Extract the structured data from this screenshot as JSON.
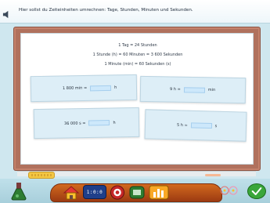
{
  "instruction": "Hier sollst du Zeiteinheiten umrechnen: Tage, Stunden, Minuten und Sekunden.",
  "rules": [
    "1 Tag = 24 Stunden",
    "1 Stunde (h) = 60 Minuten = 3 600 Sekunden",
    "1 Minute (min) = 60 Sekunden (s)"
  ],
  "exercises": [
    {
      "left": "1 800 min =",
      "value": "",
      "unit": "h"
    },
    {
      "left": "9 h =",
      "value": "",
      "unit": "min"
    },
    {
      "left": "36 000 s =",
      "value": "",
      "unit": "h"
    },
    {
      "left": "5 h =",
      "value": "",
      "unit": "s"
    }
  ],
  "toolbar": {
    "calculator_label": "1:0:0",
    "icons": [
      "flask-icon",
      "home-icon",
      "calculator-icon",
      "help-icon",
      "table-icon",
      "chart-icon",
      "decoration-icon",
      "check-icon"
    ]
  },
  "colors": {
    "board_frame": "#b0715d",
    "card": "#ddeef7",
    "input": "#cde8fb",
    "toolbar": "#c25a1c",
    "check": "#3aa63a"
  }
}
